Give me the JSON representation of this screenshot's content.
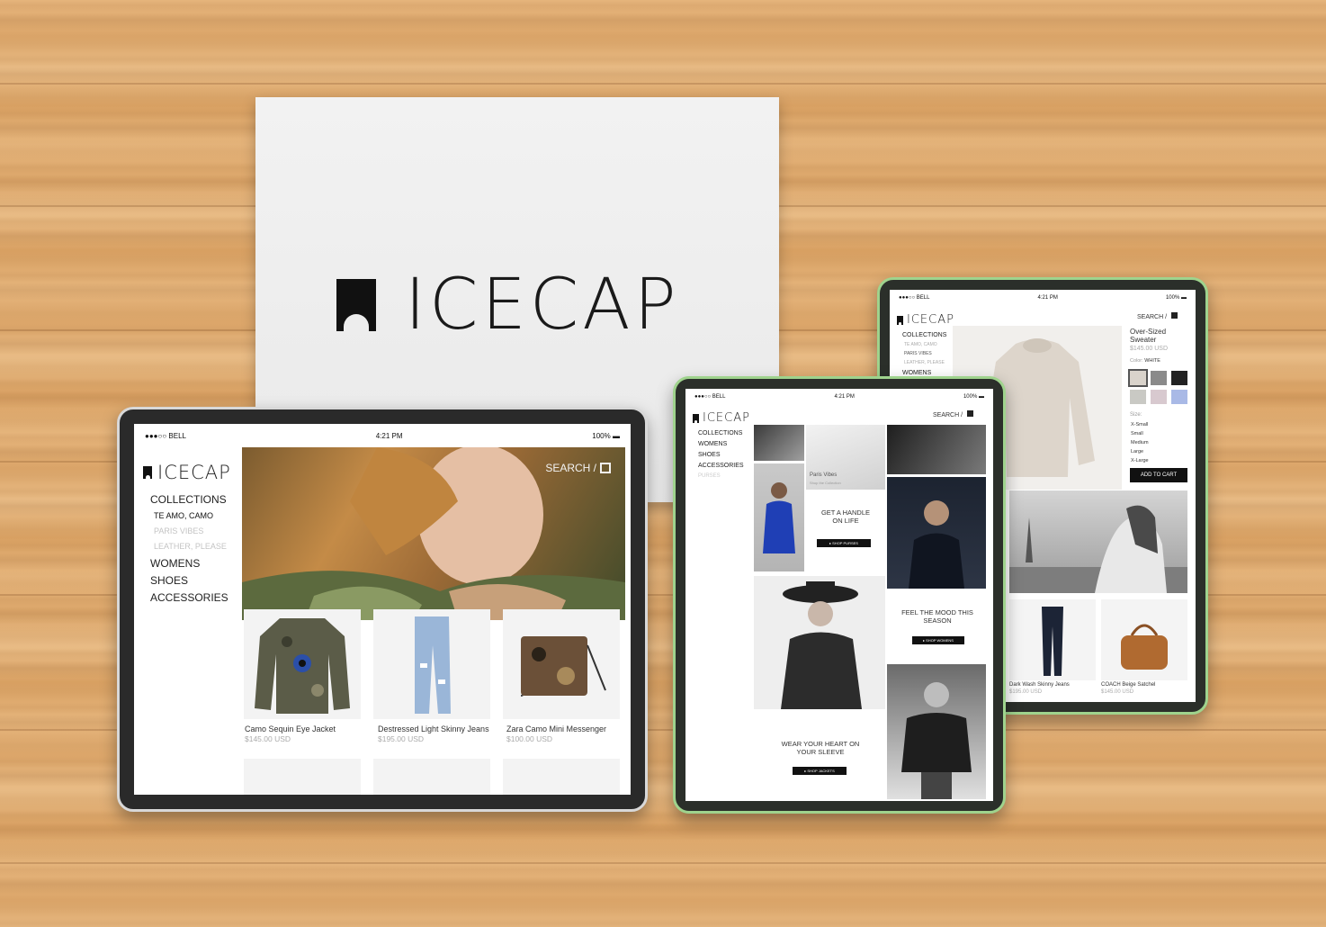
{
  "card": {
    "brand": "ICECAP"
  },
  "common": {
    "carrier": "BELL",
    "time": "4:21 PM",
    "battery": "100%",
    "brand": "ICECAP",
    "search": "SEARCH /"
  },
  "tablet_left": {
    "nav": [
      "COLLECTIONS",
      "TE AMO, CAMO",
      "PARIS VIBES",
      "LEATHER, PLEASE",
      "WOMENS",
      "SHOES",
      "ACCESSORIES"
    ],
    "products": [
      {
        "name": "Camo Sequin Eye Jacket",
        "price": "$145.00 USD"
      },
      {
        "name": "Destressed Light Skinny Jeans",
        "price": "$195.00 USD"
      },
      {
        "name": "Zara Camo Mini Messenger",
        "price": "$100.00 USD"
      }
    ]
  },
  "tablet_mid": {
    "nav": [
      "COLLECTIONS",
      "WOMENS",
      "SHOES",
      "ACCESSORIES",
      "PURSES"
    ],
    "paris_vibes": "Paris Vibes",
    "paris_sub": "Shop the Collection",
    "handle_title": "GET A HANDLE ON LIFE",
    "handle_cta": "SHOP PURSES",
    "mood_title": "FEEL THE MOOD THIS SEASON",
    "mood_cta": "SHOP WOMENS",
    "heart_title": "WEAR YOUR HEART ON YOUR SLEEVE",
    "heart_cta": "SHOP JACKETS"
  },
  "tablet_right": {
    "nav": [
      "COLLECTIONS",
      "TE AMO, CAMO",
      "PARIS VIBES",
      "LEATHER, PLEASE",
      "WOMENS"
    ],
    "product_name": "Over-Sized Sweater",
    "product_price": "$145.00 USD",
    "color_label": "Color:",
    "color_value": "WHITE",
    "size_label": "Size:",
    "sizes": [
      "X-Small",
      "Small",
      "Medium",
      "Large",
      "X-Large"
    ],
    "add_to_cart": "ADD TO CART",
    "swatch_colors": [
      "#d9d3cb",
      "#8a8a8a",
      "#222222",
      "#c9c9c4",
      "#d8c9cf",
      "#a9b9e6"
    ],
    "products": [
      {
        "name": "Dark Wash Skinny Jeans",
        "price": "$195.00 USD"
      },
      {
        "name": "COACH Beige Satchel",
        "price": "$145.00 USD"
      }
    ]
  }
}
